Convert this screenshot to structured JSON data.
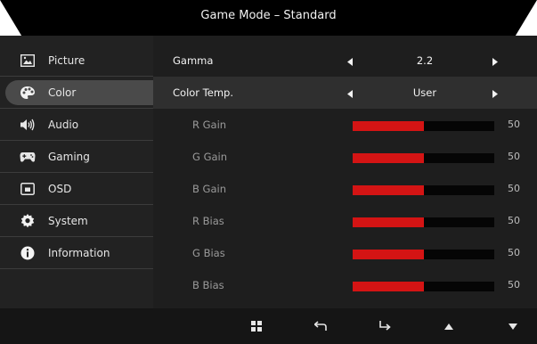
{
  "title": "Game Mode – Standard",
  "sidebar": {
    "items": [
      {
        "label": "Picture",
        "icon": "picture-icon"
      },
      {
        "label": "Color",
        "icon": "palette-icon",
        "active": true
      },
      {
        "label": "Audio",
        "icon": "speaker-icon"
      },
      {
        "label": "Gaming",
        "icon": "gamepad-icon"
      },
      {
        "label": "OSD",
        "icon": "osd-icon"
      },
      {
        "label": "System",
        "icon": "gear-icon"
      },
      {
        "label": "Information",
        "icon": "info-icon"
      }
    ]
  },
  "settings": {
    "gamma": {
      "label": "Gamma",
      "value": "2.2"
    },
    "color_temp": {
      "label": "Color Temp.",
      "value": "User"
    },
    "r_gain": {
      "label": "R Gain",
      "value": "50",
      "level_percent": 50
    },
    "g_gain": {
      "label": "G Gain",
      "value": "50",
      "level_percent": 50
    },
    "b_gain": {
      "label": "B Gain",
      "value": "50",
      "level_percent": 50
    },
    "r_bias": {
      "label": "R Bias",
      "value": "50",
      "level_percent": 50
    },
    "g_bias": {
      "label": "G Bias",
      "value": "50",
      "level_percent": 50
    },
    "b_bias": {
      "label": "B Bias",
      "value": "50",
      "level_percent": 50
    }
  },
  "bottom_buttons": [
    "menu-grid-icon",
    "back-icon",
    "enter-icon",
    "up-icon",
    "down-icon"
  ],
  "colors": {
    "bar_fill": "#d41414",
    "bar_track": "#050505",
    "panel": "#1e1e1e",
    "sidebar": "#222222"
  }
}
